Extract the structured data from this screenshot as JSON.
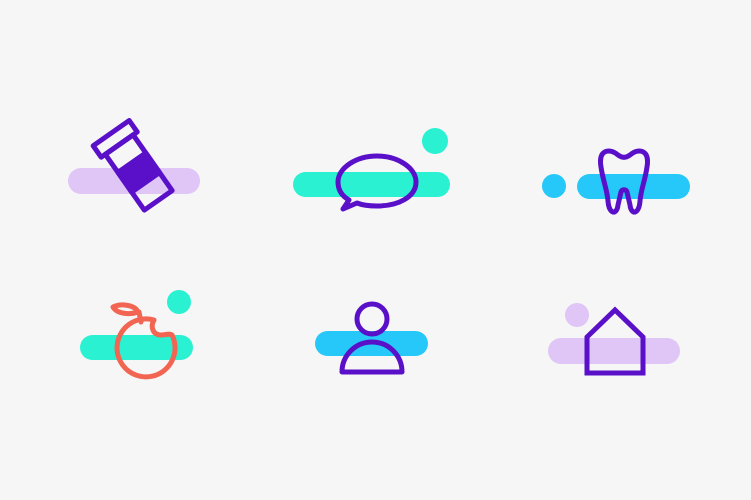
{
  "background": "#f6f6f6",
  "colors": {
    "lavender": "#dfc6f6",
    "mint": "#2af1d2",
    "sky": "#25c8f9",
    "violet": "#5a0fc8",
    "coral": "#f26552"
  },
  "icons": [
    {
      "name": "pill-bottle-icon",
      "bar_color": "#dfc6f6",
      "dot_color": null,
      "stroke_color": "#5a0fc8"
    },
    {
      "name": "speech-bubble-icon",
      "bar_color": "#2af1d2",
      "dot_color": "#2af1d2",
      "stroke_color": "#5a0fc8"
    },
    {
      "name": "tooth-icon",
      "bar_color": "#25c8f9",
      "dot_color": "#25c8f9",
      "stroke_color": "#5a0fc8"
    },
    {
      "name": "apple-icon",
      "bar_color": "#2af1d2",
      "dot_color": "#2af1d2",
      "stroke_color": "#f26552"
    },
    {
      "name": "person-icon",
      "bar_color": "#25c8f9",
      "dot_color": null,
      "stroke_color": "#5a0fc8"
    },
    {
      "name": "house-icon",
      "bar_color": "#dfc6f6",
      "dot_color": "#dfc6f6",
      "stroke_color": "#5a0fc8"
    }
  ]
}
